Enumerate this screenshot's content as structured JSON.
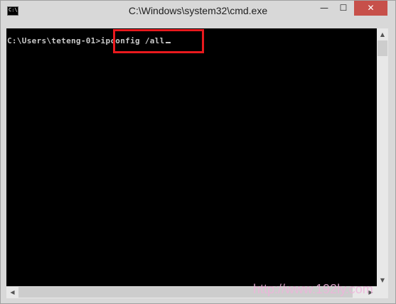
{
  "window": {
    "title": "C:\\Windows\\system32\\cmd.exe",
    "icon": "cmd-icon",
    "icon_text": "C:\\",
    "minimize_label": "—",
    "maximize_label": "☐",
    "close_label": "✕",
    "close_color": "#c7504a"
  },
  "console": {
    "prompt": "C:\\Users\\teteng-01>",
    "command": "ipconfig /all",
    "text_color": "#c8c8c8",
    "background": "#000000",
    "highlight_color": "#e8191d"
  },
  "scrollbars": {
    "up_arrow": "▲",
    "down_arrow": "▼",
    "left_arrow": "◀",
    "right_arrow": "▶"
  },
  "watermark": "http://www.192ly.com"
}
